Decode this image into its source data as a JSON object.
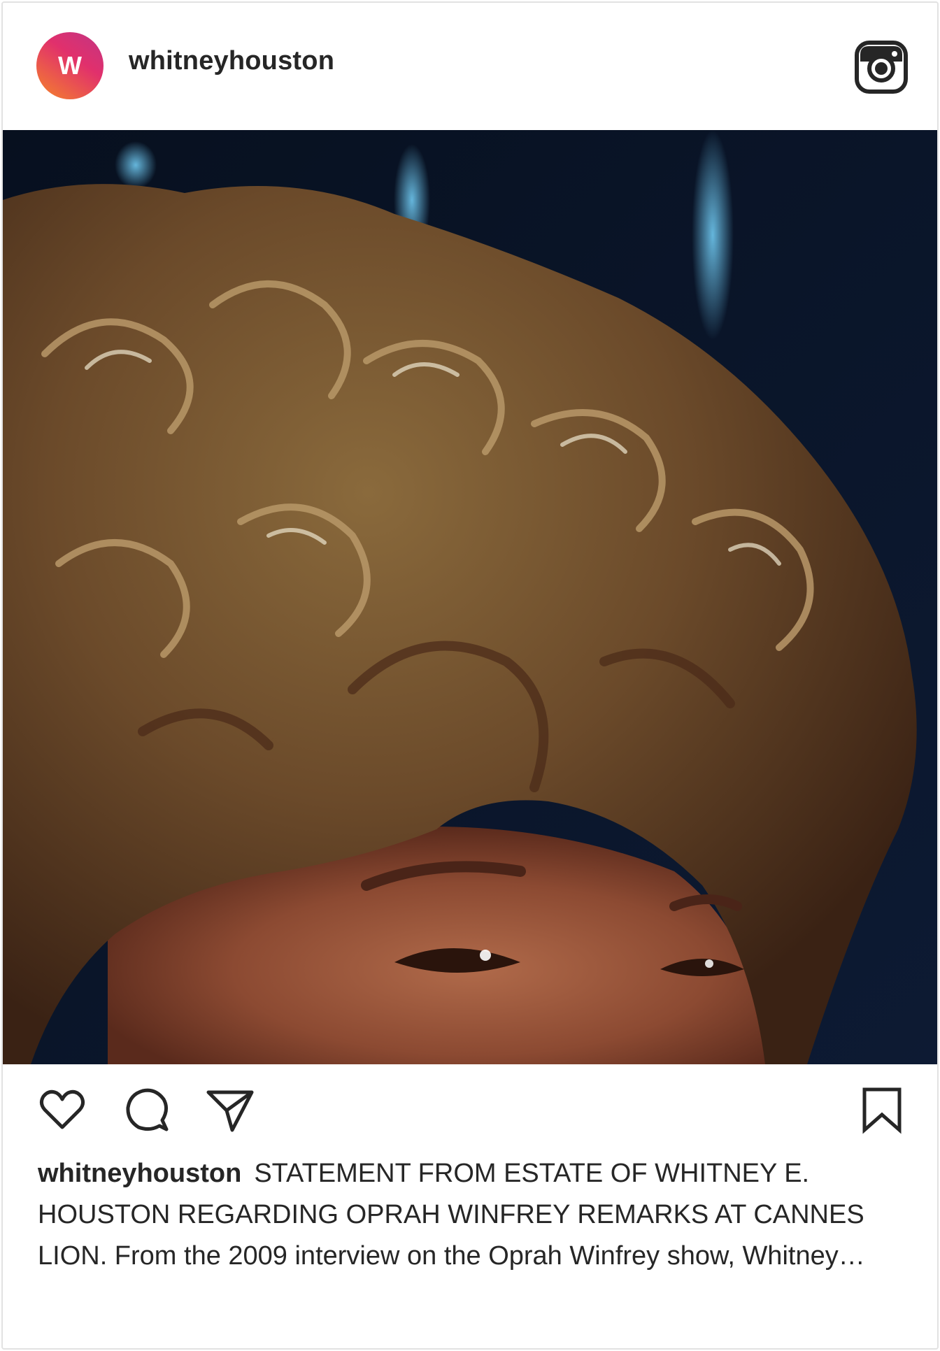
{
  "post": {
    "username": "whitneyhouston",
    "avatar_letter": "W",
    "caption_user": "whitneyhouston",
    "caption_text": "STATEMENT FROM ESTATE OF WHITNEY E. HOUSTON REGARDING OPRAH WINFREY REMARKS AT CANNES LION. From the 2009 interview on the Oprah Winfrey show, Whitney…"
  },
  "icons": {
    "header_logo": "instagram-icon",
    "like": "heart-icon",
    "comment": "comment-icon",
    "share": "send-icon",
    "save": "bookmark-icon"
  },
  "colors": {
    "text": "#262626",
    "border": "#e2e2e2",
    "avatar_gradient_start": "#f58529",
    "avatar_gradient_end": "#c13584"
  }
}
